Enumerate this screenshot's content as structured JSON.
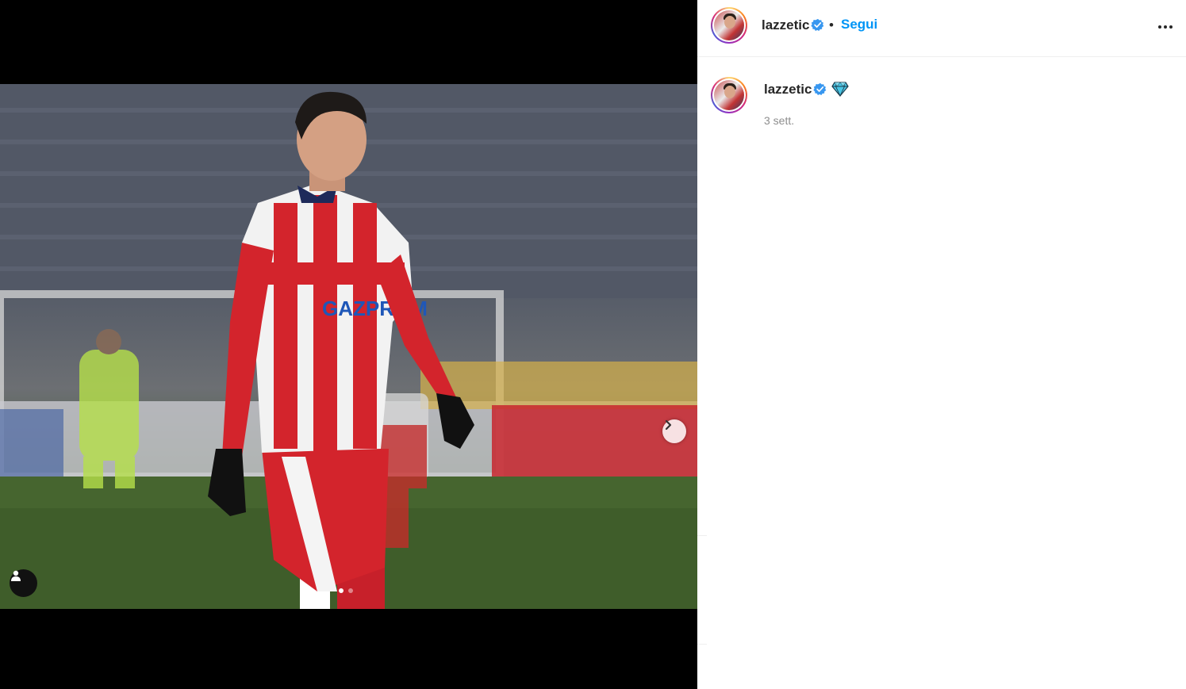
{
  "post": {
    "image_alt": "Football player in red and white striped kit on pitch",
    "carousel": {
      "current": 1,
      "total": 2
    }
  },
  "header": {
    "username": "lazzetic",
    "separator": "•",
    "follow_label": "Segui",
    "verified": true
  },
  "caption": {
    "username": "lazzetic",
    "emoji": "💎",
    "timestamp": "3 sett."
  },
  "colors": {
    "follow_blue": "#0095f6",
    "text_dark": "#262626",
    "text_muted": "#8e8e8e",
    "verified_blue": "#3897f0"
  }
}
